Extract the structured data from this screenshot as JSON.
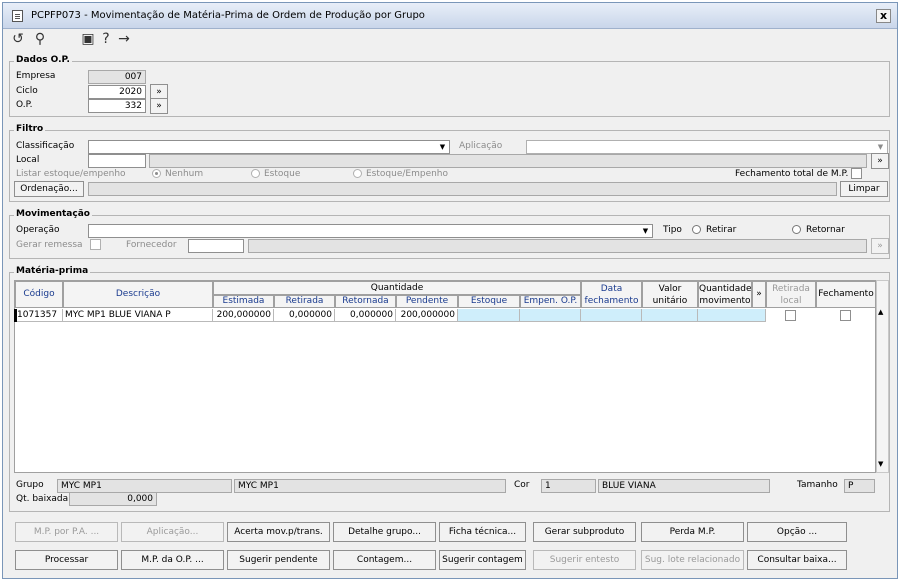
{
  "window": {
    "title": "PCPFP073 - Movimentação de Matéria-Prima de Ordem de Produção por Grupo",
    "close_label": "x"
  },
  "toolbar": {
    "icons": [
      "undo-icon",
      "search-icon",
      "calendar-icon",
      "help-icon",
      "exit-icon"
    ]
  },
  "dados_op": {
    "title": "Dados O.P.",
    "empresa_label": "Empresa",
    "empresa_value": "007",
    "ciclo_label": "Ciclo",
    "ciclo_value": "2020",
    "op_label": "O.P.",
    "op_value": "332",
    "lookup_label": "»"
  },
  "filtro": {
    "title": "Filtro",
    "classificacao_label": "Classificação",
    "classificacao_value": "",
    "aplicacao_label": "Aplicação",
    "aplicacao_value": "",
    "local_label": "Local",
    "local_value": "",
    "listar_label": "Listar estoque/empenho",
    "radio_nenhum": "Nenhum",
    "radio_estoque": "Estoque",
    "radio_estoque_empenho": "Estoque/Empenho",
    "fechamento_total_label": "Fechamento total de M.P.",
    "ordenacao_label": "Ordenação...",
    "limpar_label": "Limpar",
    "lookup_label": "»"
  },
  "movimentacao": {
    "title": "Movimentação",
    "operacao_label": "Operação",
    "operacao_value": "",
    "tipo_label": "Tipo",
    "radio_retirar": "Retirar",
    "radio_retornar": "Retornar",
    "gerar_remessa_label": "Gerar remessa",
    "fornecedor_label": "Fornecedor",
    "fornecedor_value": "",
    "lookup_label": "»"
  },
  "materia_prima": {
    "title": "Matéria-prima",
    "headers": {
      "codigo": "Código",
      "descricao": "Descrição",
      "quantidade": "Quantidade",
      "estimada": "Estimada",
      "retirada": "Retirada",
      "retornada": "Retornada",
      "pendente": "Pendente",
      "estoque": "Estoque",
      "empen_op": "Empen. O.P.",
      "data_fechamento": "Data fechamento",
      "valor_unitario": "Valor unitário",
      "quantidade_movimento": "Quantidade movimento",
      "more": "»",
      "retirada_local": "Retirada local",
      "fechamento": "Fechamento"
    },
    "rows": [
      {
        "codigo": "1071357",
        "descricao": "MYC MP1 BLUE VIANA P",
        "estimada": "200,000000",
        "retirada": "0,000000",
        "retornada": "0,000000",
        "pendente": "200,000000",
        "estoque": "",
        "empen_op": "",
        "data_fechamento": "",
        "valor_unitario": "",
        "quantidade_movimento": ""
      }
    ],
    "grupo_label": "Grupo",
    "grupo_code": "MYC MP1",
    "grupo_desc": "MYC MP1",
    "cor_label": "Cor",
    "cor_code": "1",
    "cor_desc": "BLUE VIANA",
    "tamanho_label": "Tamanho",
    "tamanho_value": "P",
    "qt_baixada_label": "Qt. baixada",
    "qt_baixada_value": "0,000"
  },
  "buttons_row1": [
    "M.P. por P.A. ...",
    "Aplicação...",
    "Acerta mov.p/trans.",
    "Detalhe grupo...",
    "Ficha técnica...",
    "Gerar subproduto",
    "Perda M.P.",
    "Opção ..."
  ],
  "buttons_row2": [
    "Processar",
    "M.P. da O.P. ...",
    "Sugerir pendente",
    "Contagem...",
    "Sugerir contagem",
    "Sugerir entesto",
    "Sug. lote relacionado",
    "Consultar baixa..."
  ]
}
